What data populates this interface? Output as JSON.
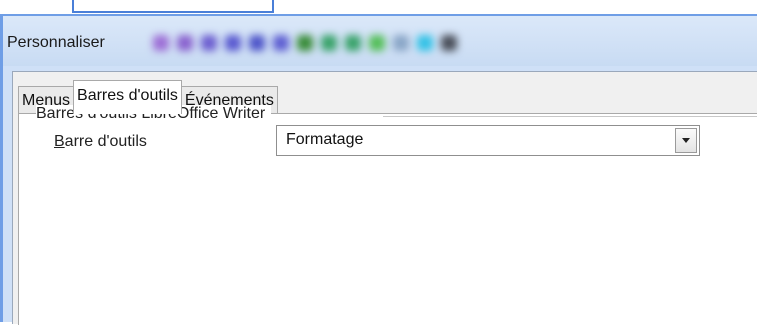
{
  "dialog": {
    "title": "Personnaliser"
  },
  "tabs": [
    {
      "label": "Menus",
      "active": false
    },
    {
      "label": "Barres d'outils",
      "active": true
    },
    {
      "label": "Événements",
      "active": false
    }
  ],
  "toolbar_group": {
    "label": "Barres d'outils LibreOffice Writer",
    "field_label_mnemonic": "B",
    "field_label_rest": "arre d'outils",
    "selected_value": "Formatage"
  },
  "blurred_icon_colors": [
    "#9d6fd6",
    "#8a63cf",
    "#6d5fd0",
    "#5a5ad0",
    "#4f56c9",
    "#5f60d2",
    "#3a8d3a",
    "#3aa36b",
    "#3aa36b",
    "#55bf5a",
    "#8aa6c7",
    "#35c2e6",
    "#4a4f5a"
  ]
}
